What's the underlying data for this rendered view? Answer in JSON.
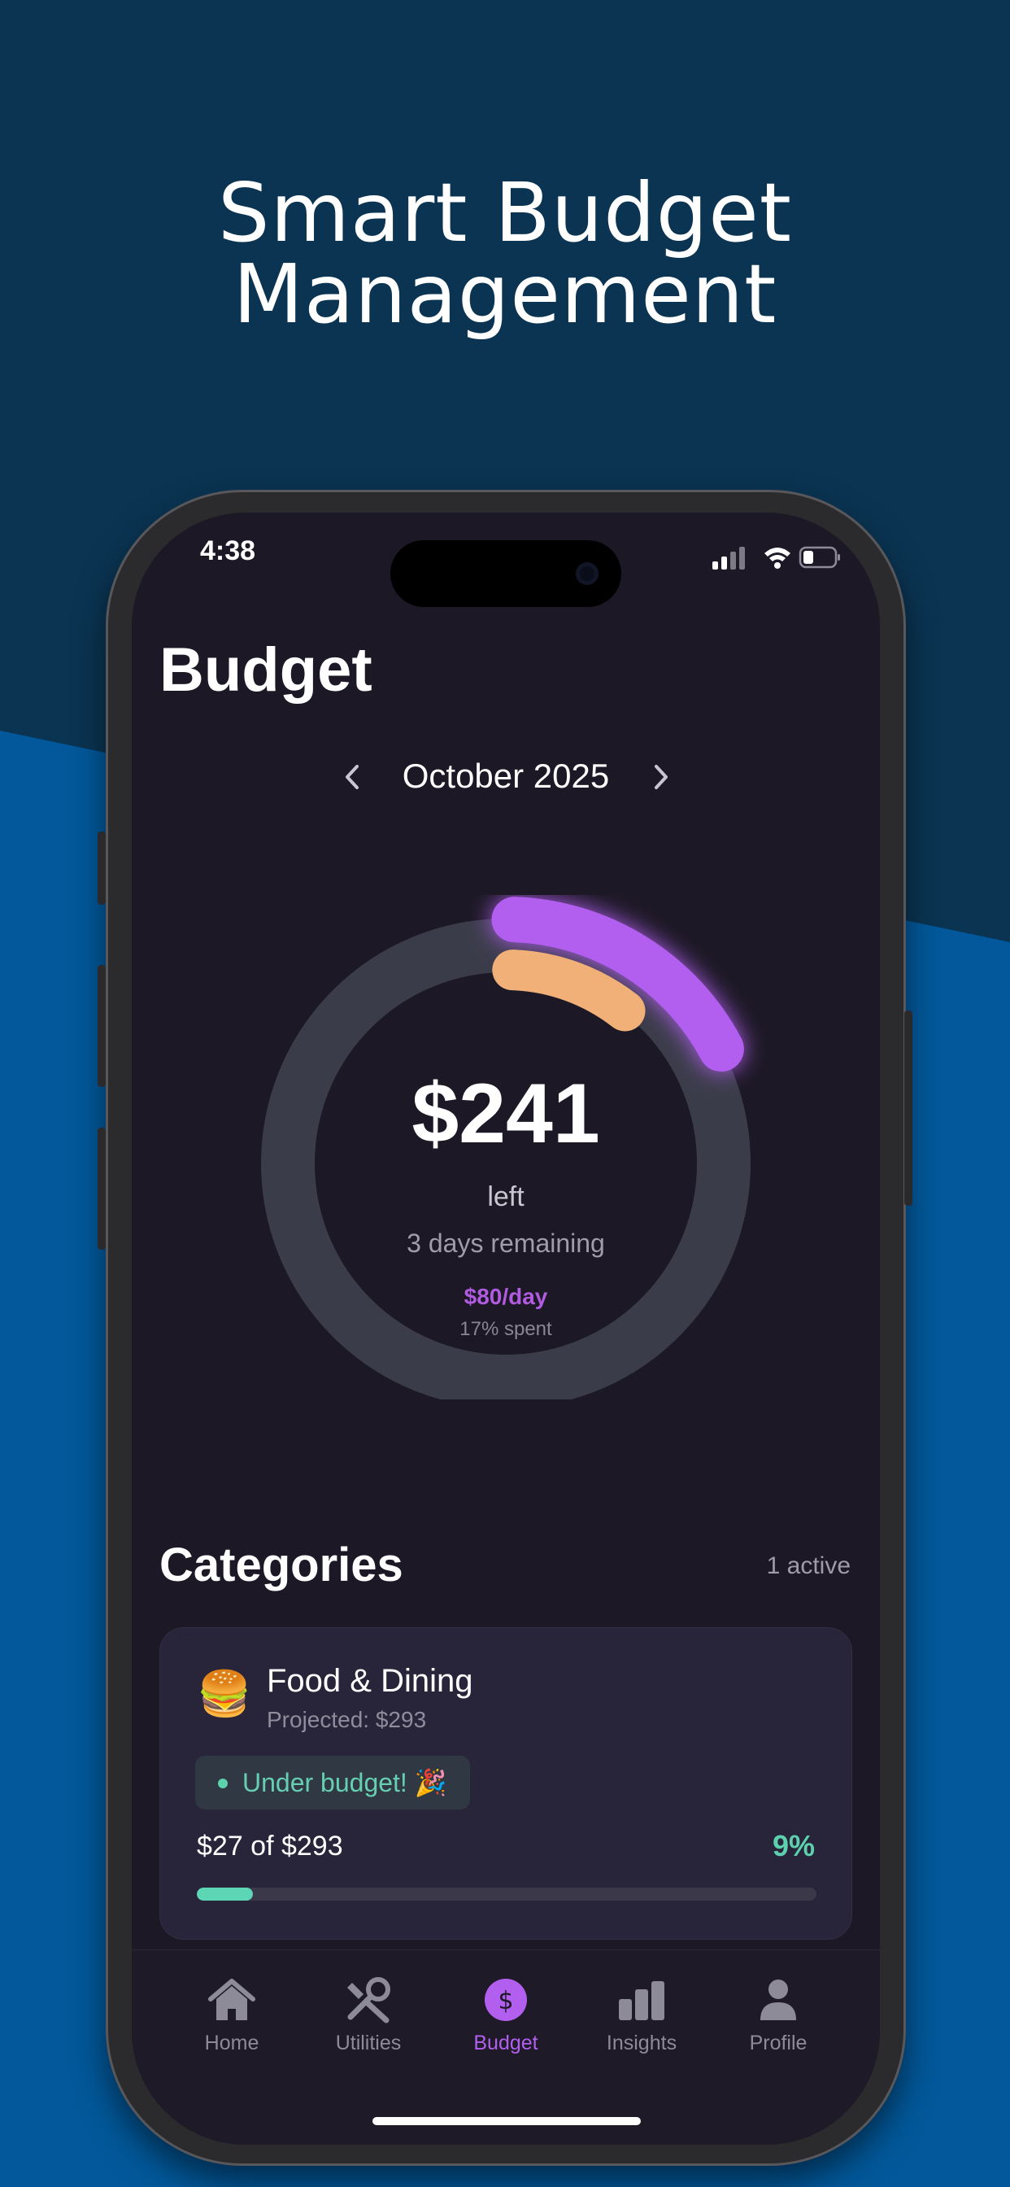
{
  "promo": {
    "headline_line1": "Smart Budget",
    "headline_line2": "Management"
  },
  "status_bar": {
    "time": "4:38"
  },
  "screen": {
    "title": "Budget",
    "month": "October 2025"
  },
  "summary": {
    "amount_left": "$241",
    "left_label": "left",
    "days_remaining": "3 days remaining",
    "per_day": "$80/day",
    "percent_spent": "17% spent"
  },
  "categories": {
    "title": "Categories",
    "active_count": "1 active",
    "items": [
      {
        "emoji": "🍔",
        "name": "Food & Dining",
        "projected": "Projected: $293",
        "status": "Under budget! 🎉",
        "spent_of": "$27 of $293",
        "percent": "9%",
        "progress": 0.09
      }
    ]
  },
  "tabs": [
    {
      "label": "Home",
      "icon": "home-icon"
    },
    {
      "label": "Utilities",
      "icon": "tools-icon"
    },
    {
      "label": "Budget",
      "icon": "dollar-icon"
    },
    {
      "label": "Insights",
      "icon": "bar-chart-icon"
    },
    {
      "label": "Profile",
      "icon": "person-icon"
    }
  ],
  "colors": {
    "accent_purple": "#b25ff0",
    "accent_orange": "#f0b078",
    "accent_green": "#5dd0ad",
    "background_dark": "#1c1825",
    "banner_top": "#0a3452",
    "banner_bottom": "#02589a"
  }
}
